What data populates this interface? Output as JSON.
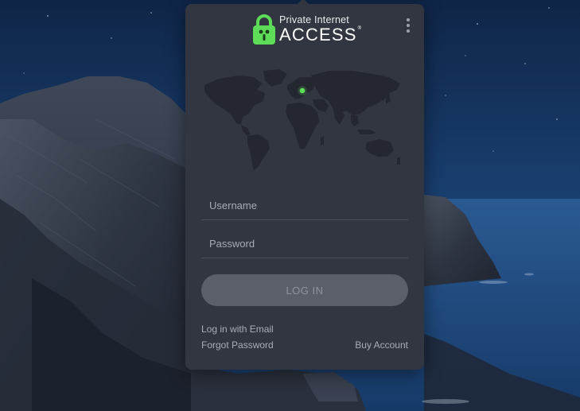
{
  "app": {
    "name": "Private Internet Access",
    "logo": {
      "line1": "Private Internet",
      "line2": "ACCESS",
      "registered": "®",
      "accent_color": "#5ddc58"
    },
    "menu_icon": "kebab-menu-icon"
  },
  "map": {
    "land_color": "#24272f",
    "location_dot_color": "#5ddc58"
  },
  "form": {
    "username_placeholder": "Username",
    "username_value": "",
    "password_placeholder": "Password",
    "password_value": "",
    "login_label": "LOG IN"
  },
  "links": {
    "email_login": "Log in with Email",
    "forgot_password": "Forgot Password",
    "buy_account": "Buy Account"
  },
  "colors": {
    "panel_bg": "#323640",
    "button_bg": "#5a5f69",
    "button_text": "#8f949d",
    "link_text": "#a9adb5",
    "divider": "#4b505a"
  }
}
